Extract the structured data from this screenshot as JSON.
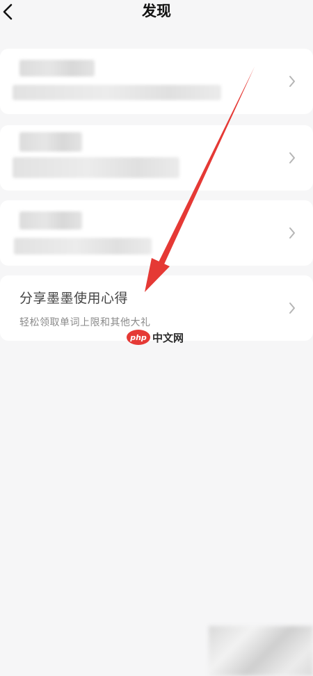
{
  "header": {
    "title": "发现"
  },
  "cards": [
    {
      "blurred": true
    },
    {
      "blurred": true
    },
    {
      "blurred": true
    },
    {
      "title": "分享墨墨使用心得",
      "subtitle": "轻松领取单词上限和其他大礼"
    }
  ],
  "watermark": {
    "badge": "php",
    "text": "中文网"
  },
  "colors": {
    "background": "#f6f6f7",
    "card": "#ffffff",
    "arrow": "#e53935",
    "chevron": "#b5b5b5"
  },
  "icons": {
    "back": "chevron-left-icon",
    "row": "chevron-right-icon"
  }
}
